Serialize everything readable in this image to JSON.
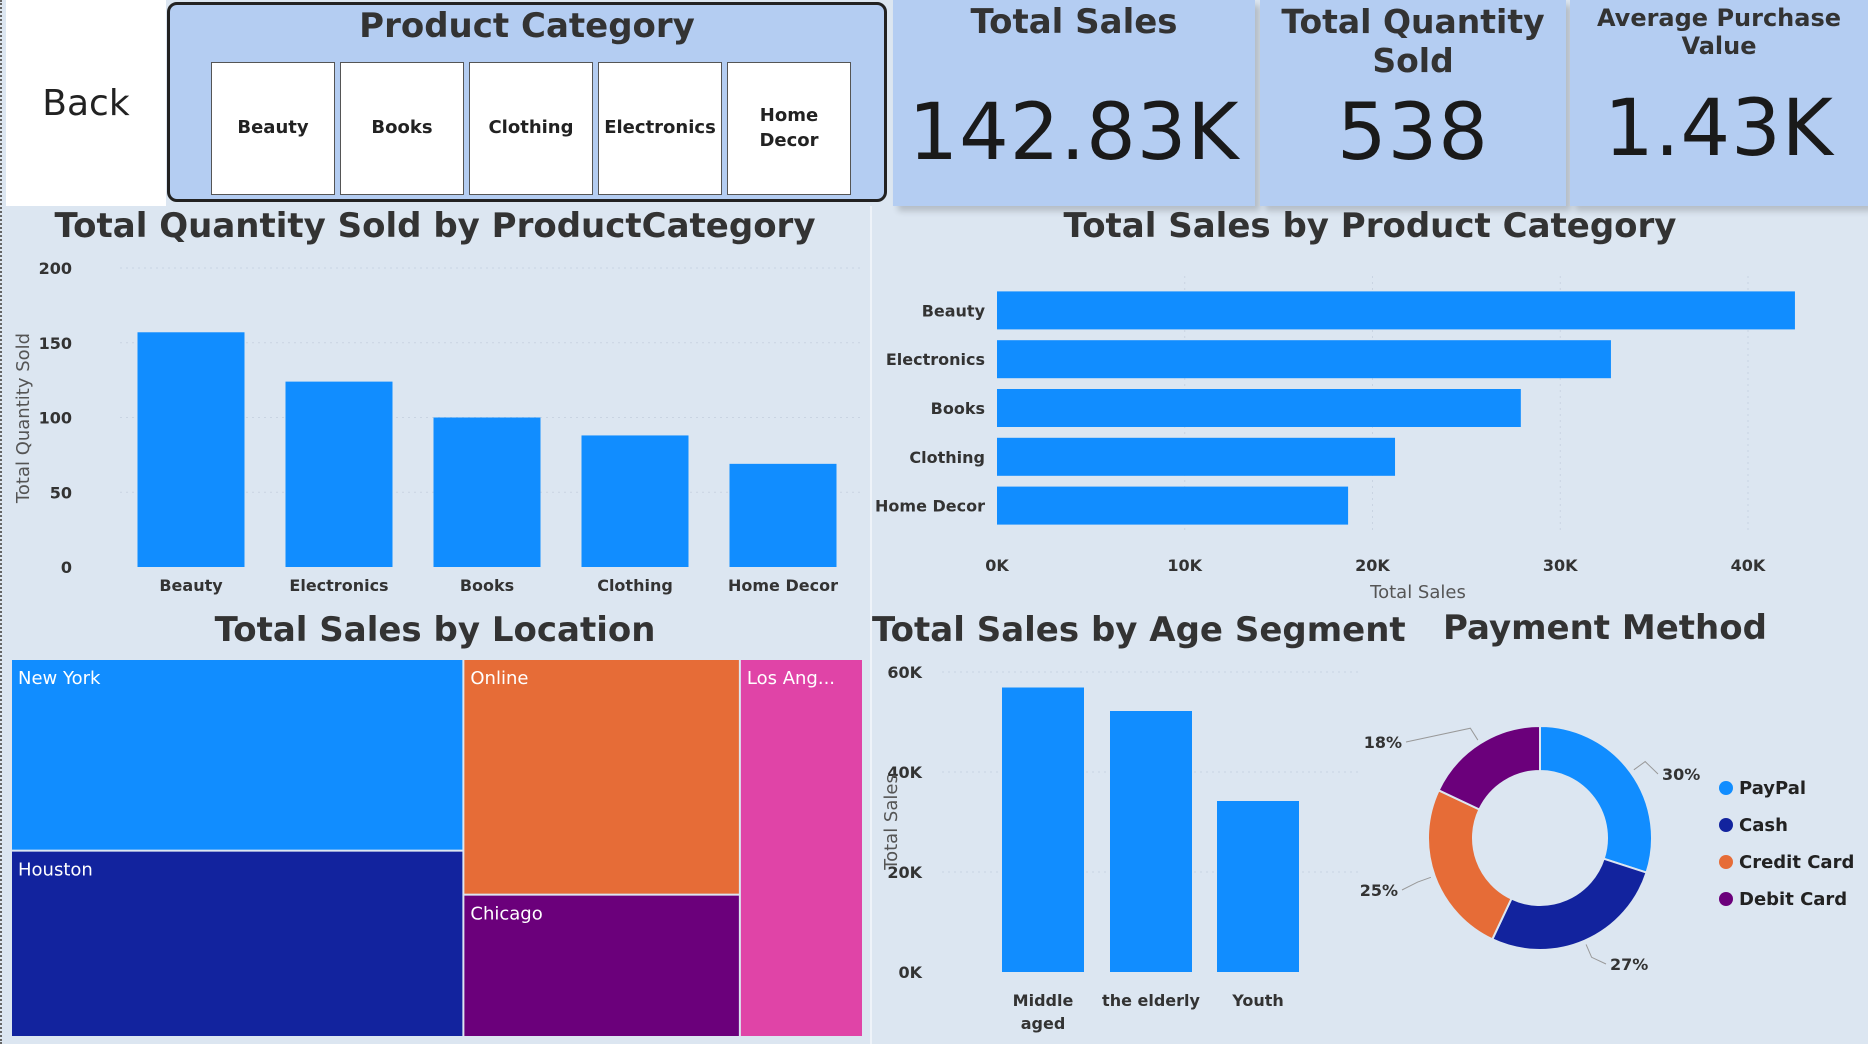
{
  "nav": {
    "back_label": "Back"
  },
  "slicer": {
    "title": "Product Category",
    "options": [
      "Beauty",
      "Books",
      "Clothing",
      "Electronics",
      "Home Decor"
    ]
  },
  "kpis": [
    {
      "title": "Total Sales",
      "value": "142.83K"
    },
    {
      "title": "Total Quantity Sold",
      "value": "538"
    },
    {
      "title": "Average Purchase Value",
      "value": "1.43K"
    }
  ],
  "colors": {
    "primary": "#118dff",
    "navy": "#12239e",
    "orange": "#e66c37",
    "purple": "#6b007b",
    "pink": "#e044a7"
  },
  "chart_data": [
    {
      "type": "bar",
      "title": "Total Quantity Sold by ProductCategory",
      "ylabel": "Total Quantity Sold",
      "categories": [
        "Beauty",
        "Electronics",
        "Books",
        "Clothing",
        "Home Decor"
      ],
      "values": [
        157,
        124,
        100,
        88,
        69
      ],
      "ylim": [
        0,
        200
      ],
      "yticks": [
        "200",
        "150",
        "100",
        "50",
        "0"
      ]
    },
    {
      "type": "bar",
      "orientation": "horizontal",
      "title": "Total Sales by Product Category",
      "xlabel": "Total Sales",
      "categories": [
        "Beauty",
        "Electronics",
        "Books",
        "Clothing",
        "Home Decor"
      ],
      "values": [
        42500,
        32700,
        27900,
        21200,
        18700
      ],
      "xlim": [
        0,
        45000
      ],
      "xticks": [
        "0K",
        "10K",
        "20K",
        "30K",
        "40K"
      ]
    },
    {
      "type": "treemap",
      "title": "Total Sales by Location",
      "items": [
        {
          "name": "New York",
          "value": 32600,
          "color": "#118dff"
        },
        {
          "name": "Houston",
          "value": 31700,
          "color": "#12239e"
        },
        {
          "name": "Online",
          "value": 24500,
          "color": "#e66c37"
        },
        {
          "name": "Chicago",
          "value": 14800,
          "color": "#6b007b"
        },
        {
          "name": "Los Ang...",
          "value": 17500,
          "color": "#e044a7"
        }
      ]
    },
    {
      "type": "bar",
      "title": "Total Sales by Age Segment",
      "ylabel": "Total Sales",
      "categories": [
        "Middle aged",
        "the elderly",
        "Youth"
      ],
      "category_lines": [
        [
          "Middle",
          "aged"
        ],
        [
          "the elderly"
        ],
        [
          "Youth"
        ]
      ],
      "values": [
        56900,
        52200,
        34200
      ],
      "ylim": [
        0,
        60000
      ],
      "yticks": [
        "60K",
        "40K",
        "20K",
        "0K"
      ]
    },
    {
      "type": "pie",
      "donut": true,
      "title": "Payment Method",
      "slices": [
        {
          "name": "PayPal",
          "value": 30,
          "label": "30%",
          "color": "#118dff"
        },
        {
          "name": "Cash",
          "value": 27,
          "label": "27%",
          "color": "#12239e"
        },
        {
          "name": "Credit Card",
          "value": 25,
          "label": "25%",
          "color": "#e66c37"
        },
        {
          "name": "Debit Card",
          "value": 18,
          "label": "18%",
          "color": "#6b007b"
        }
      ],
      "legend_position": "right"
    }
  ]
}
